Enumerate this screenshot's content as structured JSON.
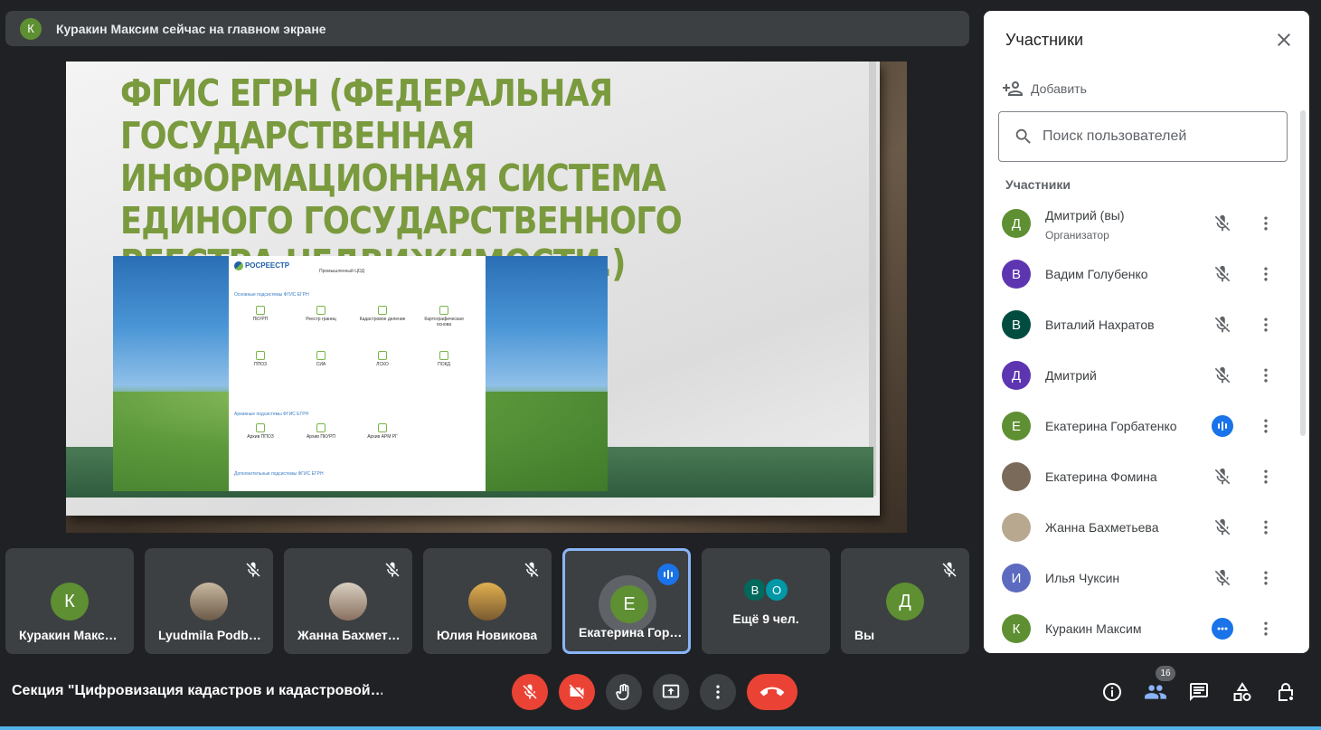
{
  "banner": {
    "avatar_letter": "К",
    "text": "Куракин Максим сейчас на главном экране"
  },
  "slide": {
    "title": "ФГИС ЕГРН (ФЕДЕРАЛЬНАЯ ГОСУДАРСТВЕННАЯ ИНФОРМАЦИОННАЯ СИСТЕМА ЕДИНОГО ГОСУДАРСТВЕННОГО РЕЕСТРА НЕДВИЖИМОСТИ.)",
    "doc": {
      "logo": "РОСРЕЕСТР",
      "env": "Промышленный ЦОД",
      "section1": "Основные подсистемы ФГИС ЕГРН",
      "row1": [
        "ПКУРП",
        "Реестр границ",
        "Кадастровое деление",
        "Картографическая основа"
      ],
      "row2": [
        "ППОЗ",
        "СИА",
        "ЛСКО",
        "ПОКД"
      ],
      "section2": "Архивные подсистемы ФГИС ЕГРН",
      "row3": [
        "Архив ППОЗ",
        "Архив ПКУРП",
        "Архив АРМ РГ"
      ],
      "section3": "Дополнительные подсистемы ФГИС ЕГРН"
    }
  },
  "tiles": [
    {
      "name": "Куракин Макс…",
      "letter": "К",
      "color": "#5e8f32"
    },
    {
      "name": "Lyudmila Podb…"
    },
    {
      "name": "Жанна Бахмет…"
    },
    {
      "name": "Юлия Новикова"
    },
    {
      "name": "Екатерина Гор…",
      "letter": "Е",
      "color": "#5e8f32"
    },
    {
      "more_label": "Ещё 9 чел.",
      "avatars": [
        {
          "letter": "В",
          "color": "#00695c"
        },
        {
          "letter": "О",
          "color": "#0097a7"
        }
      ]
    },
    {
      "name": "Вы",
      "letter": "Д",
      "color": "#5e8f32"
    }
  ],
  "bottom": {
    "meeting_title": "Секция \"Цифровизация кадастров и кадастровой…",
    "participants_count": "16"
  },
  "panel": {
    "title": "Участники",
    "add_label": "Добавить",
    "search_placeholder": "Поиск пользователей",
    "section_label": "Участники",
    "people": [
      {
        "name": "Дмитрий (вы)",
        "sub": "Организатор",
        "letter": "Д",
        "color": "#5e8f32",
        "status": "muted"
      },
      {
        "name": "Вадим Голубенко",
        "letter": "В",
        "color": "#5e35b1",
        "status": "muted"
      },
      {
        "name": "Виталий Нахратов",
        "letter": "В",
        "color": "#004d40",
        "status": "muted"
      },
      {
        "name": "Дмитрий",
        "letter": "Д",
        "color": "#5e35b1",
        "status": "muted"
      },
      {
        "name": "Екатерина Горбатенко",
        "letter": "Е",
        "color": "#5e8f32",
        "status": "speaking"
      },
      {
        "name": "Екатерина Фомина",
        "letter": "",
        "color": "#7a6a5a",
        "status": "muted"
      },
      {
        "name": "Жанна Бахметьева",
        "letter": "",
        "color": "#b8a890",
        "status": "muted"
      },
      {
        "name": "Илья Чуксин",
        "letter": "И",
        "color": "#5c6bc0",
        "status": "muted"
      },
      {
        "name": "Куракин Максим",
        "letter": "К",
        "color": "#5e8f32",
        "status": "presenting"
      }
    ]
  }
}
